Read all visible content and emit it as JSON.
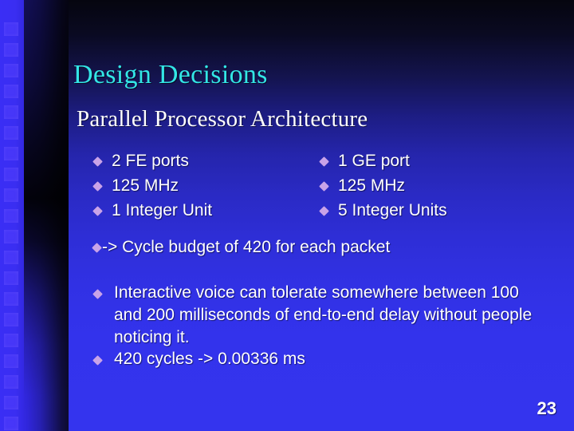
{
  "slide": {
    "title": "Design Decisions",
    "subtitle": "Parallel Processor Architecture",
    "page_number": "23",
    "colors": {
      "title": "#33e6e6",
      "body_text": "#ffffff",
      "bullet_diamond": "#c9a3e8",
      "background_top": "#05050f",
      "background_bottom": "#3434ee",
      "left_band": "#3a2ef5"
    },
    "columns": {
      "left": [
        {
          "bullet": "diamond-bullet-icon",
          "text": "2 FE ports"
        },
        {
          "bullet": "diamond-bullet-icon",
          "text": "125 MHz"
        },
        {
          "bullet": "diamond-bullet-icon",
          "text": "1 Integer Unit"
        }
      ],
      "right": [
        {
          "bullet": "diamond-bullet-icon",
          "text": "1 GE port"
        },
        {
          "bullet": "diamond-bullet-icon",
          "text": "125 MHz"
        },
        {
          "bullet": "diamond-bullet-icon",
          "text": "5 Integer Units"
        }
      ]
    },
    "paragraphs": {
      "cycle_budget": "-> Cycle budget of 420 for each packet",
      "tolerance": "Interactive voice can tolerate somewhere between 100 and 200 milliseconds of end-to-end delay without people noticing it.",
      "cycles_to_ms": "420 cycles -> 0.00336 ms"
    }
  }
}
